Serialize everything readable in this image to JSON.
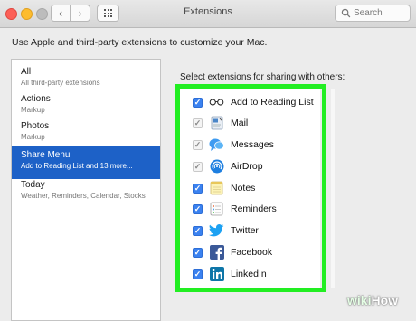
{
  "window": {
    "title": "Extensions"
  },
  "toolbar": {
    "back_glyph": "‹",
    "forward_glyph": "›",
    "grid_icon": "grid-icon"
  },
  "search": {
    "placeholder": "Search"
  },
  "intro_text": "Use Apple and third-party extensions to customize your Mac.",
  "sidebar": {
    "items": [
      {
        "title": "All",
        "subtitle": "All third-party extensions",
        "selected": false
      },
      {
        "title": "Actions",
        "subtitle": "Markup",
        "selected": false
      },
      {
        "title": "Photos",
        "subtitle": "Markup",
        "selected": false
      },
      {
        "title": "Share Menu",
        "subtitle": "Add to Reading List and 13 more...",
        "selected": true
      },
      {
        "title": "Today",
        "subtitle": "Weather, Reminders, Calendar, Stocks",
        "selected": false
      }
    ]
  },
  "share": {
    "heading": "Select extensions for sharing with others:",
    "items": [
      {
        "label": "Add to Reading List",
        "checked": true,
        "enabled": true,
        "icon": "glasses-icon"
      },
      {
        "label": "Mail",
        "checked": true,
        "enabled": false,
        "icon": "mail-icon"
      },
      {
        "label": "Messages",
        "checked": true,
        "enabled": false,
        "icon": "messages-icon"
      },
      {
        "label": "AirDrop",
        "checked": true,
        "enabled": false,
        "icon": "airdrop-icon"
      },
      {
        "label": "Notes",
        "checked": true,
        "enabled": true,
        "icon": "notes-icon"
      },
      {
        "label": "Reminders",
        "checked": true,
        "enabled": true,
        "icon": "reminders-icon"
      },
      {
        "label": "Twitter",
        "checked": true,
        "enabled": true,
        "icon": "twitter-icon"
      },
      {
        "label": "Facebook",
        "checked": true,
        "enabled": true,
        "icon": "facebook-icon"
      },
      {
        "label": "LinkedIn",
        "checked": true,
        "enabled": true,
        "icon": "linkedin-icon"
      }
    ]
  },
  "checkmark": "✓",
  "watermark": {
    "prefix": "wiki",
    "suffix": "How"
  },
  "colors": {
    "selection": "#1d61c7",
    "checkbox": "#3b82f0",
    "highlight": "#22ee22"
  }
}
